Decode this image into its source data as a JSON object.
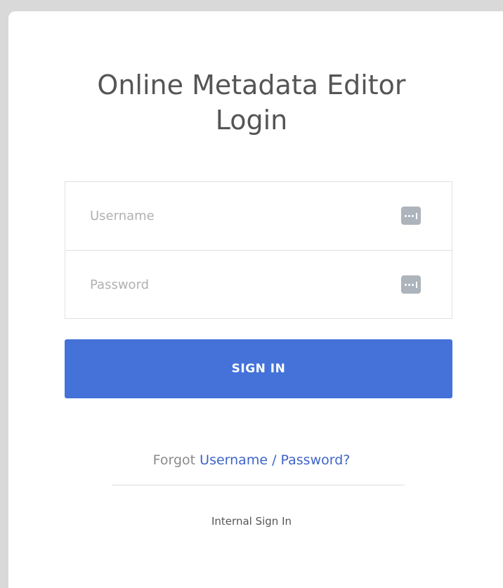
{
  "login": {
    "title_line1": "Online Metadata Editor",
    "title_line2": "Login",
    "username_placeholder": "Username",
    "username_value": "",
    "password_placeholder": "Password",
    "password_value": "",
    "password_manager_icon": "key-password-manager-icon",
    "signin_label": "SIGN IN",
    "forgot_prefix": "Forgot",
    "forgot_username": "Username",
    "forgot_separator": "/",
    "forgot_password": "Password?",
    "internal_signin": "Internal Sign In"
  },
  "colors": {
    "accent": "#4472d9",
    "link": "#3e64c8",
    "background": "#d9d9d9",
    "card": "#ffffff"
  }
}
